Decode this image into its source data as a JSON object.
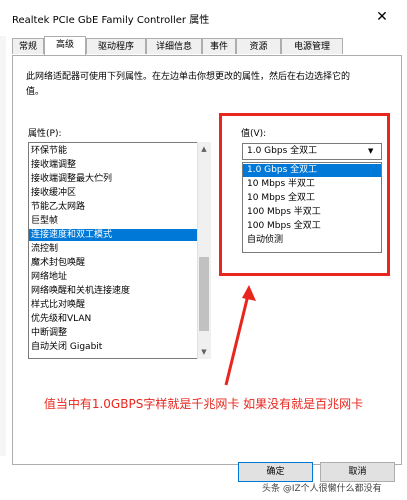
{
  "window": {
    "title": "Realtek PCIe GbE Family Controller 属性",
    "close_glyph": "✕"
  },
  "tabs": [
    {
      "label": "常规"
    },
    {
      "label": "高级"
    },
    {
      "label": "驱动程序"
    },
    {
      "label": "详细信息"
    },
    {
      "label": "事件"
    },
    {
      "label": "资源"
    },
    {
      "label": "电源管理"
    }
  ],
  "active_tab": "高级",
  "description": "此网络适配器可使用下列属性。在左边单击你想更改的属性，然后在右边选择它的值。",
  "properties": {
    "label": "属性(P):",
    "selected": "连接速度和双工模式",
    "items": [
      "环保节能",
      "接收端调整",
      "接收端调整最大伫列",
      "接收缓冲区",
      "节能乙太网路",
      "巨型帧",
      "连接速度和双工模式",
      "流控制",
      "魔术封包唤醒",
      "网络地址",
      "网络唤醒和关机连接速度",
      "样式比对唤醒",
      "优先级和VLAN",
      "中断调整",
      "自动关闭 Gigabit"
    ]
  },
  "value": {
    "label": "值(V):",
    "current": "1.0 Gbps 全双工",
    "options": [
      "1.0 Gbps 全双工",
      "10 Mbps 半双工",
      "10 Mbps 全双工",
      "100 Mbps 半双工",
      "100 Mbps 全双工",
      "自动侦测"
    ]
  },
  "annotation": "值当中有1.0GBPS字样就是千兆网卡 如果没有就是百兆网卡",
  "buttons": {
    "ok": "确定",
    "cancel": "取消"
  },
  "watermark": "头条 @IZ个人很懒什么都没有",
  "colors": {
    "accent": "#0078d7",
    "annotation_red": "#e8261e"
  }
}
